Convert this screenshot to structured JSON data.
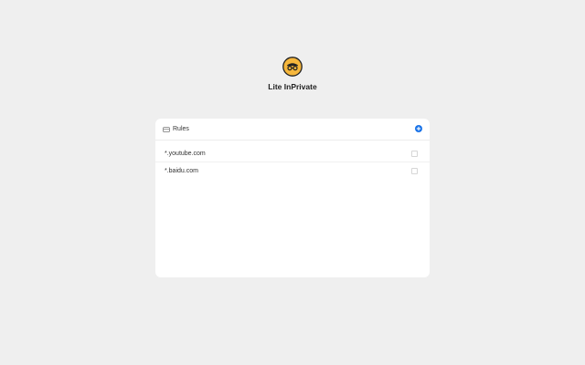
{
  "app": {
    "title": "Lite InPrivate",
    "logo_icon": "incognito-face-icon",
    "logo_color": "#f6b73c"
  },
  "rules_panel": {
    "header_label": "Rules",
    "header_icon": "rules-icon",
    "add_icon": "plus-icon",
    "accent_color": "#1a73e8",
    "rules": [
      {
        "pattern": "*.youtube.com",
        "checked": false
      },
      {
        "pattern": "*.baidu.com",
        "checked": false
      }
    ]
  }
}
